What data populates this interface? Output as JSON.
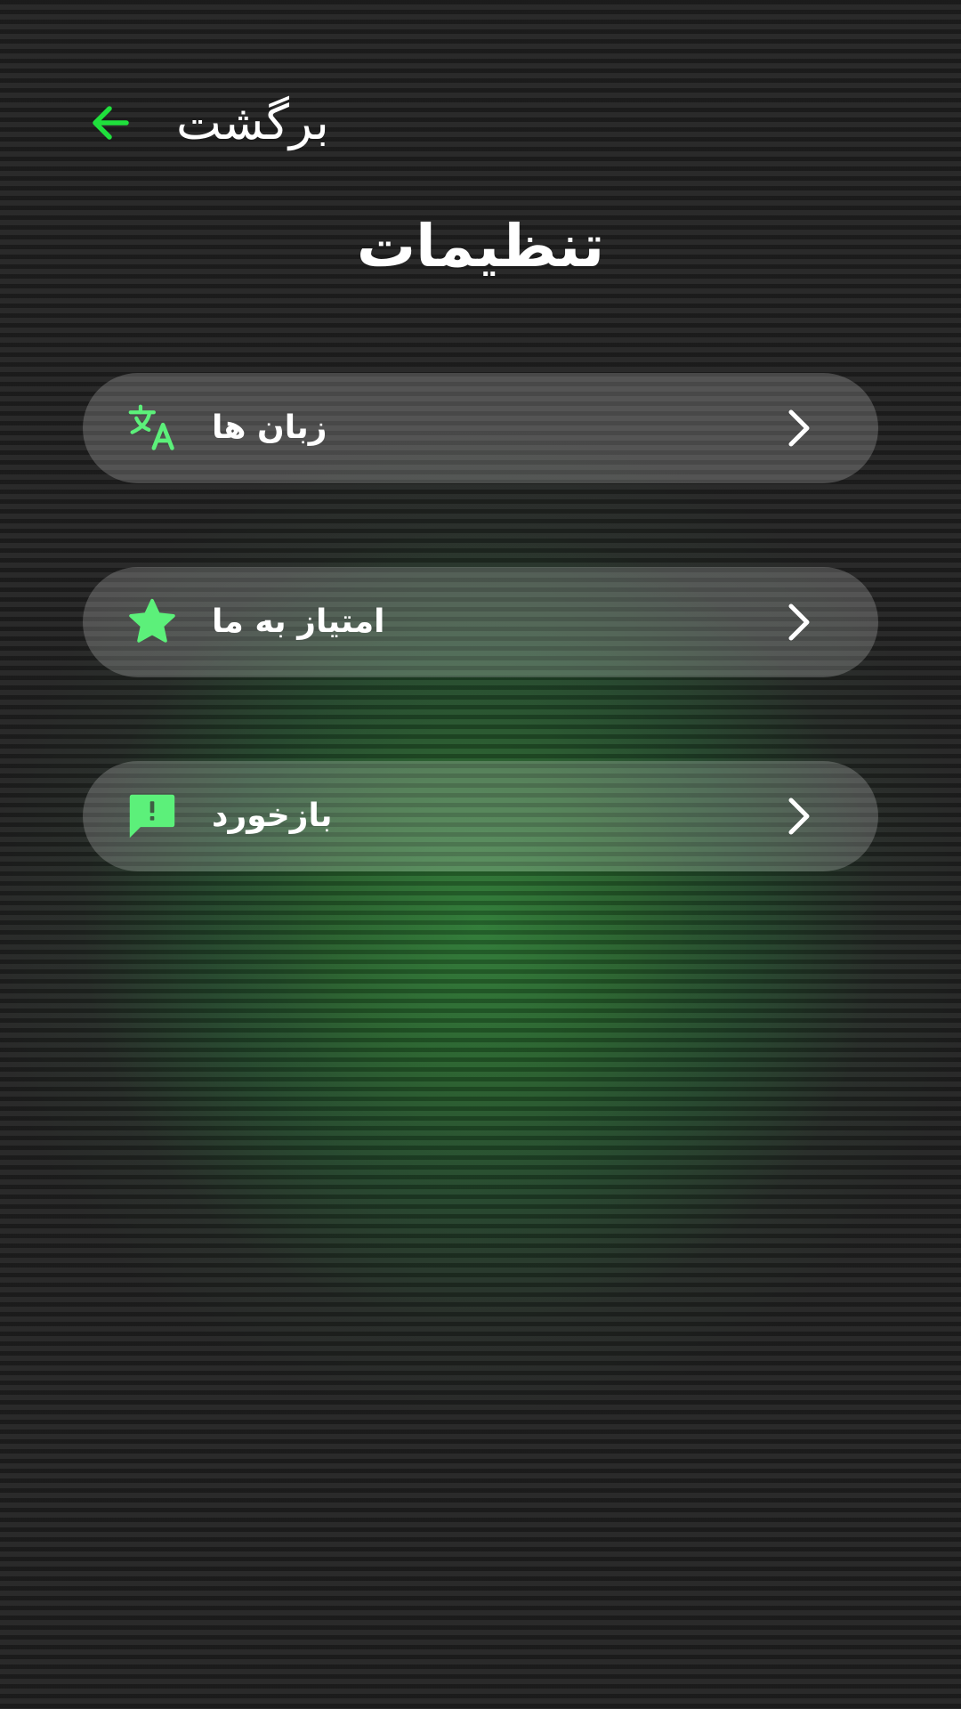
{
  "header": {
    "back_label": "برگشت",
    "back_icon": "arrow-left-icon",
    "title": "تنظیمات"
  },
  "menu": {
    "items": [
      {
        "label": "زبان ها",
        "icon": "translate-icon"
      },
      {
        "label": "امتیاز به ما",
        "icon": "star-icon"
      },
      {
        "label": "بازخورد",
        "icon": "feedback-icon"
      }
    ]
  },
  "colors": {
    "accent": "#5cf07a",
    "back_arrow": "#1fe03c",
    "text": "#ffffff",
    "background": "#232323",
    "glow": "#2d7a35"
  }
}
